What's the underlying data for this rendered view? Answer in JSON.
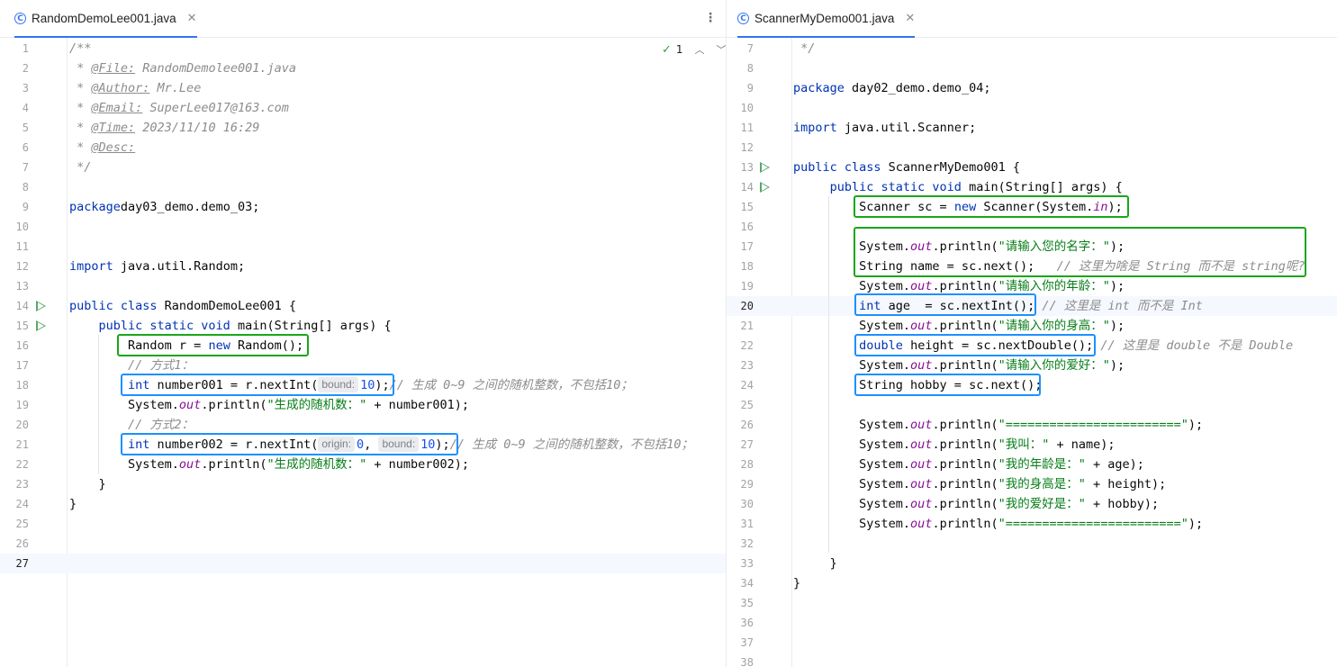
{
  "left": {
    "tab": "RandomDemoLee001.java",
    "inspection": {
      "count": "1"
    },
    "lines": [
      {
        "n": "1",
        "t": [
          [
            "cm",
            "/**"
          ]
        ]
      },
      {
        "n": "2",
        "t": [
          [
            "cm",
            " * "
          ],
          [
            "tag",
            "@File:"
          ],
          [
            "cm",
            " RandomDemolee001.java"
          ]
        ]
      },
      {
        "n": "3",
        "t": [
          [
            "cm",
            " * "
          ],
          [
            "tag",
            "@Author:"
          ],
          [
            "cm",
            " Mr.Lee"
          ]
        ]
      },
      {
        "n": "4",
        "t": [
          [
            "cm",
            " * "
          ],
          [
            "tag",
            "@Email:"
          ],
          [
            "cm",
            " SuperLee017@163.com"
          ]
        ]
      },
      {
        "n": "5",
        "t": [
          [
            "cm",
            " * "
          ],
          [
            "tag",
            "@Time:"
          ],
          [
            "cm",
            " 2023/11/10 16:29"
          ]
        ]
      },
      {
        "n": "6",
        "t": [
          [
            "cm",
            " * "
          ],
          [
            "tag",
            "@Desc:"
          ]
        ]
      },
      {
        "n": "7",
        "t": [
          [
            "cm",
            " */"
          ]
        ]
      },
      {
        "n": "8",
        "t": []
      },
      {
        "n": "9",
        "t": [
          [
            "kw",
            "package"
          ],
          [
            "",
            "day03_demo.demo_03;"
          ]
        ]
      },
      {
        "n": "10",
        "t": []
      },
      {
        "n": "11",
        "t": []
      },
      {
        "n": "12",
        "t": [
          [
            "kw",
            "import"
          ],
          [
            "",
            " java.util.Random;"
          ]
        ]
      },
      {
        "n": "13",
        "t": []
      },
      {
        "n": "14",
        "run": true,
        "t": [
          [
            "kw",
            "public class"
          ],
          [
            "",
            " RandomDemoLee001 {"
          ]
        ]
      },
      {
        "n": "15",
        "run": true,
        "t": [
          [
            "",
            "    "
          ],
          [
            "kw",
            "public static void"
          ],
          [
            "",
            " main(String[] args) {"
          ]
        ]
      },
      {
        "n": "16",
        "t": [
          [
            "",
            "        Random r = "
          ],
          [
            "kw",
            "new"
          ],
          [
            "",
            " Random();"
          ]
        ]
      },
      {
        "n": "17",
        "t": [
          [
            "",
            "        "
          ],
          [
            "cm",
            "// 方式1："
          ]
        ]
      },
      {
        "n": "18",
        "t": [
          [
            "",
            "        "
          ],
          [
            "kw",
            "int"
          ],
          [
            "",
            " number001 = r.nextInt("
          ],
          [
            "hint",
            "bound:"
          ],
          [
            "nm",
            "10"
          ],
          [
            "",
            ");"
          ],
          [
            "cm",
            "// 生成 0~9 之间的随机整数，不包括10；"
          ]
        ]
      },
      {
        "n": "19",
        "t": [
          [
            "",
            "        System."
          ],
          [
            "fld",
            "out"
          ],
          [
            "",
            ".println("
          ],
          [
            "st",
            "\"生成的随机数：\""
          ],
          [
            "",
            " + number001);"
          ]
        ]
      },
      {
        "n": "20",
        "t": [
          [
            "",
            "        "
          ],
          [
            "cm",
            "// 方式2："
          ]
        ]
      },
      {
        "n": "21",
        "t": [
          [
            "",
            "        "
          ],
          [
            "kw",
            "int"
          ],
          [
            "",
            " number002 = r.nextInt("
          ],
          [
            "hint",
            "origin:"
          ],
          [
            "nm",
            "0"
          ],
          [
            "",
            ", "
          ],
          [
            "hint",
            "bound:"
          ],
          [
            "nm",
            "10"
          ],
          [
            "",
            ");"
          ],
          [
            "cm",
            "// 生成 0~9 之间的随机整数，不包括10；"
          ]
        ]
      },
      {
        "n": "22",
        "t": [
          [
            "",
            "        System."
          ],
          [
            "fld",
            "out"
          ],
          [
            "",
            ".println("
          ],
          [
            "st",
            "\"生成的随机数：\""
          ],
          [
            "",
            " + number002);"
          ]
        ]
      },
      {
        "n": "23",
        "t": [
          [
            "",
            "    }"
          ]
        ]
      },
      {
        "n": "24",
        "t": [
          [
            "",
            "}"
          ]
        ]
      },
      {
        "n": "25",
        "t": []
      },
      {
        "n": "26",
        "t": []
      },
      {
        "n": "27",
        "t": [],
        "current": true
      }
    ]
  },
  "right": {
    "tab": "ScannerMyDemo001.java",
    "lines": [
      {
        "n": "7",
        "t": [
          [
            "cm",
            " */"
          ]
        ]
      },
      {
        "n": "8",
        "t": []
      },
      {
        "n": "9",
        "t": [
          [
            "kw",
            "package"
          ],
          [
            "",
            " day02_demo.demo_04;"
          ]
        ]
      },
      {
        "n": "10",
        "t": []
      },
      {
        "n": "11",
        "t": [
          [
            "kw",
            "import"
          ],
          [
            "",
            " java.util.Scanner;"
          ]
        ]
      },
      {
        "n": "12",
        "t": []
      },
      {
        "n": "13",
        "run": true,
        "t": [
          [
            "kw",
            "public class"
          ],
          [
            "",
            " ScannerMyDemo001 {"
          ]
        ]
      },
      {
        "n": "14",
        "run": true,
        "t": [
          [
            "",
            "     "
          ],
          [
            "kw",
            "public static void"
          ],
          [
            "",
            " main(String[] args) {"
          ]
        ]
      },
      {
        "n": "15",
        "t": [
          [
            "",
            "         Scanner sc = "
          ],
          [
            "kw",
            "new"
          ],
          [
            "",
            " Scanner(System."
          ],
          [
            "fld",
            "in"
          ],
          [
            "",
            ");"
          ]
        ]
      },
      {
        "n": "16",
        "t": []
      },
      {
        "n": "17",
        "t": [
          [
            "",
            "         System."
          ],
          [
            "fld",
            "out"
          ],
          [
            "",
            ".println("
          ],
          [
            "st",
            "\"请输入您的名字：\""
          ],
          [
            "",
            ");"
          ]
        ]
      },
      {
        "n": "18",
        "t": [
          [
            "",
            "         String name = sc.next();   "
          ],
          [
            "cm",
            "// 这里为啥是 String 而不是 string呢?"
          ]
        ]
      },
      {
        "n": "19",
        "t": [
          [
            "",
            "         System."
          ],
          [
            "fld",
            "out"
          ],
          [
            "",
            ".println("
          ],
          [
            "st",
            "\"请输入你的年龄：\""
          ],
          [
            "",
            ");"
          ]
        ]
      },
      {
        "n": "20",
        "current": true,
        "t": [
          [
            "",
            "         "
          ],
          [
            "kw",
            "int"
          ],
          [
            "",
            " age  = sc.nextInt(); "
          ],
          [
            "cm",
            "// 这里是 int 而不是 Int"
          ]
        ]
      },
      {
        "n": "21",
        "t": [
          [
            "",
            "         System."
          ],
          [
            "fld",
            "out"
          ],
          [
            "",
            ".println("
          ],
          [
            "st",
            "\"请输入你的身高：\""
          ],
          [
            "",
            ");"
          ]
        ]
      },
      {
        "n": "22",
        "t": [
          [
            "",
            "         "
          ],
          [
            "kw",
            "double"
          ],
          [
            "",
            " height = sc.nextDouble(); "
          ],
          [
            "cm",
            "// 这里是 double 不是 Double"
          ]
        ]
      },
      {
        "n": "23",
        "t": [
          [
            "",
            "         System."
          ],
          [
            "fld",
            "out"
          ],
          [
            "",
            ".println("
          ],
          [
            "st",
            "\"请输入你的爱好：\""
          ],
          [
            "",
            ");"
          ]
        ]
      },
      {
        "n": "24",
        "t": [
          [
            "",
            "         String hobby = sc.next();"
          ]
        ]
      },
      {
        "n": "25",
        "t": []
      },
      {
        "n": "26",
        "t": [
          [
            "",
            "         System."
          ],
          [
            "fld",
            "out"
          ],
          [
            "",
            ".println("
          ],
          [
            "st",
            "\"========================\""
          ],
          [
            "",
            ");"
          ]
        ]
      },
      {
        "n": "27",
        "t": [
          [
            "",
            "         System."
          ],
          [
            "fld",
            "out"
          ],
          [
            "",
            ".println("
          ],
          [
            "st",
            "\"我叫：\""
          ],
          [
            "",
            " + name);"
          ]
        ]
      },
      {
        "n": "28",
        "t": [
          [
            "",
            "         System."
          ],
          [
            "fld",
            "out"
          ],
          [
            "",
            ".println("
          ],
          [
            "st",
            "\"我的年龄是：\""
          ],
          [
            "",
            " + age);"
          ]
        ]
      },
      {
        "n": "29",
        "t": [
          [
            "",
            "         System."
          ],
          [
            "fld",
            "out"
          ],
          [
            "",
            ".println("
          ],
          [
            "st",
            "\"我的身高是：\""
          ],
          [
            "",
            " + height);"
          ]
        ]
      },
      {
        "n": "30",
        "t": [
          [
            "",
            "         System."
          ],
          [
            "fld",
            "out"
          ],
          [
            "",
            ".println("
          ],
          [
            "st",
            "\"我的爱好是：\""
          ],
          [
            "",
            " + hobby);"
          ]
        ]
      },
      {
        "n": "31",
        "t": [
          [
            "",
            "         System."
          ],
          [
            "fld",
            "out"
          ],
          [
            "",
            ".println("
          ],
          [
            "st",
            "\"========================\""
          ],
          [
            "",
            ");"
          ]
        ]
      },
      {
        "n": "32",
        "t": []
      },
      {
        "n": "33",
        "t": [
          [
            "",
            "     }"
          ]
        ]
      },
      {
        "n": "34",
        "t": [
          [
            "",
            "}"
          ]
        ]
      },
      {
        "n": "35",
        "t": []
      },
      {
        "n": "36",
        "t": []
      },
      {
        "n": "37",
        "t": []
      },
      {
        "n": "38",
        "t": []
      }
    ]
  },
  "colors": {
    "accent": "#3574f0",
    "green_box": "#1aa61a",
    "blue_box": "#1e90ff"
  }
}
